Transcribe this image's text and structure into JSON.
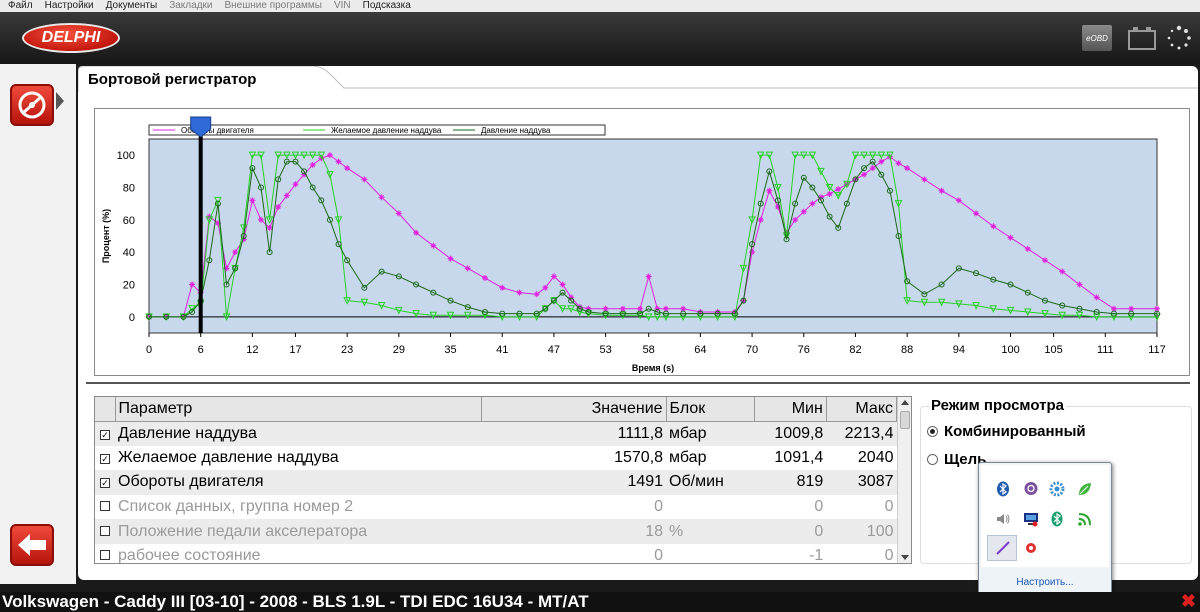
{
  "menu": [
    "Файл",
    "Настройки",
    "Документы",
    "Закладки",
    "Внешние программы",
    "VIN",
    "Подсказка"
  ],
  "menu_disabled": [
    false,
    false,
    false,
    true,
    true,
    true,
    false
  ],
  "header": {
    "logo": "DELPHI",
    "eobd": "eOBD"
  },
  "page_title": "Бортовой регистратор",
  "chart_data": {
    "type": "line",
    "xlabel": "Время (s)",
    "ylabel": "Процент (%)",
    "xlim": [
      0,
      117
    ],
    "ylim": [
      -10,
      110
    ],
    "xticks": [
      0,
      6,
      12,
      17,
      23,
      29,
      35,
      41,
      47,
      53,
      58,
      64,
      70,
      76,
      82,
      88,
      94,
      100,
      105,
      111,
      117
    ],
    "yticks": [
      0,
      20,
      40,
      60,
      80,
      100
    ],
    "cursor_x": 6,
    "background": "#c8d8ec",
    "series": [
      {
        "name": "Обороты двигателя",
        "color": "#e020e0",
        "x": [
          0,
          2,
          4,
          5,
          6,
          7,
          8,
          9,
          10,
          11,
          12,
          13,
          14,
          15,
          16,
          17,
          18,
          19,
          20,
          21,
          22,
          23,
          25,
          27,
          29,
          31,
          33,
          35,
          37,
          39,
          41,
          43,
          45,
          46,
          47,
          48,
          49,
          50,
          51,
          53,
          55,
          57,
          58,
          59,
          60,
          62,
          64,
          66,
          68,
          69,
          70,
          71,
          72,
          73,
          74,
          75,
          76,
          77,
          78,
          79,
          80,
          81,
          82,
          83,
          84,
          85,
          86,
          87,
          88,
          90,
          92,
          94,
          96,
          98,
          100,
          102,
          104,
          106,
          108,
          110,
          112,
          114,
          117
        ],
        "y": [
          0,
          0,
          0,
          20,
          15,
          62,
          58,
          30,
          40,
          48,
          72,
          60,
          55,
          68,
          75,
          82,
          88,
          94,
          98,
          100,
          96,
          92,
          85,
          74,
          64,
          52,
          44,
          36,
          30,
          24,
          18,
          15,
          14,
          18,
          25,
          20,
          12,
          6,
          5,
          5,
          5,
          5,
          25,
          5,
          5,
          5,
          3,
          3,
          3,
          10,
          40,
          60,
          78,
          68,
          52,
          60,
          65,
          70,
          74,
          76,
          79,
          82,
          85,
          88,
          92,
          96,
          99,
          95,
          92,
          85,
          78,
          72,
          64,
          56,
          49,
          42,
          35,
          28,
          20,
          12,
          5,
          5,
          5
        ]
      },
      {
        "name": "Желаемое давление наддува",
        "color": "#28d028",
        "x": [
          0,
          2,
          4,
          5,
          6,
          7,
          8,
          9,
          10,
          11,
          12,
          13,
          14,
          15,
          16,
          17,
          18,
          19,
          20,
          21,
          22,
          23,
          25,
          27,
          29,
          31,
          33,
          35,
          37,
          39,
          41,
          43,
          45,
          46,
          47,
          48,
          49,
          50,
          51,
          53,
          55,
          57,
          58,
          59,
          60,
          62,
          64,
          66,
          68,
          69,
          70,
          71,
          72,
          73,
          74,
          75,
          76,
          77,
          78,
          79,
          80,
          81,
          82,
          83,
          84,
          85,
          86,
          87,
          88,
          90,
          92,
          94,
          96,
          98,
          100,
          102,
          104,
          106,
          108,
          110,
          112,
          114,
          117
        ],
        "y": [
          0,
          0,
          0,
          5,
          8,
          60,
          72,
          0,
          30,
          55,
          100,
          100,
          60,
          100,
          100,
          100,
          100,
          100,
          100,
          88,
          60,
          10,
          9,
          7,
          4,
          2,
          1,
          1,
          1,
          1,
          0,
          0,
          0,
          5,
          10,
          5,
          5,
          3,
          2,
          1,
          1,
          1,
          0,
          0,
          0,
          0,
          0,
          0,
          0,
          30,
          60,
          100,
          100,
          80,
          50,
          100,
          100,
          100,
          90,
          80,
          75,
          82,
          100,
          100,
          100,
          100,
          100,
          70,
          10,
          9,
          9,
          8,
          7,
          5,
          4,
          3,
          2,
          1,
          1,
          0,
          0,
          0,
          0
        ]
      },
      {
        "name": "Давление наддува",
        "color": "#1a6a1a",
        "x": [
          0,
          2,
          4,
          5,
          6,
          7,
          8,
          9,
          10,
          11,
          12,
          13,
          14,
          15,
          16,
          17,
          18,
          19,
          20,
          21,
          22,
          23,
          25,
          27,
          29,
          31,
          33,
          35,
          37,
          39,
          41,
          43,
          45,
          46,
          47,
          48,
          49,
          50,
          51,
          53,
          55,
          57,
          58,
          59,
          60,
          62,
          64,
          66,
          68,
          69,
          70,
          71,
          72,
          73,
          74,
          75,
          76,
          77,
          78,
          79,
          80,
          81,
          82,
          83,
          84,
          85,
          86,
          87,
          88,
          90,
          92,
          94,
          96,
          98,
          100,
          102,
          104,
          106,
          108,
          110,
          112,
          114,
          117
        ],
        "y": [
          0,
          0,
          0,
          3,
          10,
          35,
          70,
          20,
          30,
          50,
          92,
          80,
          40,
          85,
          96,
          96,
          90,
          80,
          72,
          60,
          45,
          35,
          18,
          28,
          25,
          20,
          15,
          10,
          6,
          3,
          2,
          2,
          2,
          5,
          10,
          15,
          10,
          5,
          3,
          2,
          2,
          2,
          5,
          3,
          2,
          2,
          2,
          2,
          2,
          10,
          45,
          70,
          90,
          72,
          48,
          70,
          86,
          80,
          72,
          62,
          55,
          70,
          85,
          92,
          96,
          88,
          78,
          50,
          22,
          14,
          20,
          30,
          27,
          23,
          20,
          15,
          10,
          7,
          5,
          3,
          2,
          2,
          2
        ]
      }
    ]
  },
  "table": {
    "headers": [
      "Параметр",
      "Значение",
      "Блок",
      "Мин",
      "Макс"
    ],
    "rows": [
      {
        "checked": true,
        "name": "Давление наддува",
        "value": "1111,8",
        "unit": "мбар",
        "min": "1009,8",
        "max": "2213,4"
      },
      {
        "checked": true,
        "name": "Желаемое давление наддува",
        "value": "1570,8",
        "unit": "мбар",
        "min": "1091,4",
        "max": "2040"
      },
      {
        "checked": true,
        "name": "Обороты двигателя",
        "value": "1491",
        "unit": "Об/мин",
        "min": "819",
        "max": "3087"
      },
      {
        "checked": false,
        "name": "Список данных, группа номер 2",
        "value": "0",
        "unit": "",
        "min": "0",
        "max": "0"
      },
      {
        "checked": false,
        "name": "Положение педали акселератора",
        "value": "18",
        "unit": "%",
        "min": "0",
        "max": "100"
      },
      {
        "checked": false,
        "name": "рабочее состояние",
        "value": "0",
        "unit": "",
        "min": "-1",
        "max": "0"
      }
    ]
  },
  "view_mode": {
    "title": "Режим просмотра",
    "options": [
      "Комбинированный",
      "Щель"
    ],
    "selected": 0
  },
  "tray": {
    "link": "Настроить...",
    "icons": [
      "bluetooth-icon",
      "viber-icon",
      "settings-gear-icon",
      "leaf-icon",
      "volume-icon",
      "network-icon",
      "bluetooth-green-icon",
      "wifi-signal-icon",
      "pen-icon",
      "antivirus-icon"
    ]
  },
  "statusbar": "Volkswagen - Caddy III [03-10] - 2008 - BLS 1.9L - TDI EDC 16U34 - MT/AT",
  "close": "✖"
}
